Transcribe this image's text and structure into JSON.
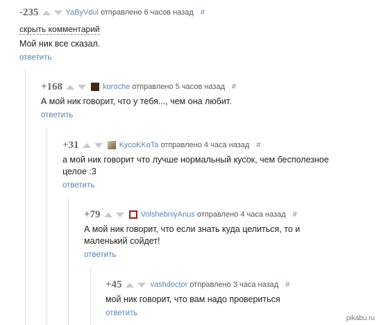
{
  "comments": [
    {
      "score": "-235",
      "author": "YaByVdul",
      "time": "отправлено 6 часов назад",
      "hash": "#",
      "hide_label": "скрыть комментарий",
      "text": "Мой ник все сказал.",
      "reply": "ответить"
    },
    {
      "score": "+168",
      "author": "koroche",
      "time": "отправлено 5 часов назад",
      "hash": "#",
      "text": "А мой ник говорит, что у тебя..., чем она любит.",
      "reply": "ответить"
    },
    {
      "score": "+31",
      "author": "KycoKKoTa",
      "time": "отправлено 4 часа назад",
      "hash": "#",
      "text": "а мой ник говорит что лучше нормальный кусок, чем бесполезное целое :3",
      "reply": "ответить"
    },
    {
      "score": "+79",
      "author": "VolshebniyAnus",
      "time": "отправлено 4 часа назад",
      "hash": "#",
      "text": "А мой ник говорит, что если знать куда целиться, то и маленький сойдет!",
      "reply": "ответить"
    },
    {
      "score": "+45",
      "author": "vashdoctor",
      "time": "отправлено 3 часа назад",
      "hash": "#",
      "text": "мой ник говорит, что вам надо провериться",
      "reply": "ответить"
    }
  ],
  "watermark": "pikabu.ru",
  "colors": {
    "link": "#5b85b3",
    "score": "#6b6b6b",
    "thread_line": "#e3e3e3"
  }
}
